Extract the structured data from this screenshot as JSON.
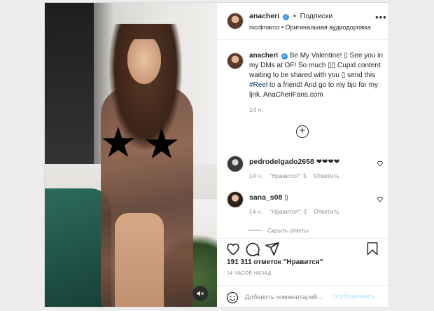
{
  "header": {
    "username": "anacheri",
    "follow_label": "Подписки",
    "audio_text": "nicdimarco • Оригинальная аудиодорожка",
    "more": "•••"
  },
  "caption": {
    "username": "anacheri",
    "text_1": "Be My Valentine! ",
    "glyph_1": "▯",
    "text_2": " See you in my DMs at OF! So much ",
    "glyph_2": "▯▯",
    "text_3": " Cupid content waiting to be shared with you ",
    "glyph_3": "▯",
    "text_4": " send this ",
    "hashtag": "#Reel",
    "text_5": " to a friend! And go to my bjo for my ljnk. AnaCheriFans.com",
    "time": "14 ч.",
    "load_more": "+"
  },
  "comments": [
    {
      "username": "pedrodelgado2658",
      "text": "❤❤❤❤",
      "time": "14 ч.",
      "likes": "\"Нравится\": 5",
      "reply": "Ответить"
    },
    {
      "username": "sana_s08",
      "text": "▯",
      "time": "14 ч.",
      "likes": "\"Нравится\": 3",
      "reply": "Ответить"
    }
  ],
  "hide_replies": "Скрыть ответы",
  "likes_text": "191 311 отметок \"Нравится\"",
  "post_time": "14 ЧАСОВ НАЗАД",
  "add_comment": {
    "placeholder": "Добавить комментарий...",
    "publish": "Опубликовать"
  },
  "media": {
    "censor_symbol": "★"
  },
  "icons": {
    "verified": "verified-badge-icon",
    "like": "heart-icon",
    "comment": "comment-icon",
    "share": "paper-plane-icon",
    "save": "bookmark-icon",
    "emoji": "smiley-icon",
    "sound": "speaker-muted-icon"
  },
  "colors": {
    "verified_blue": "#3897f0",
    "hashtag": "#00376b",
    "publish_disabled": "#b2dffc",
    "secondary_text": "#8e8e8e"
  }
}
